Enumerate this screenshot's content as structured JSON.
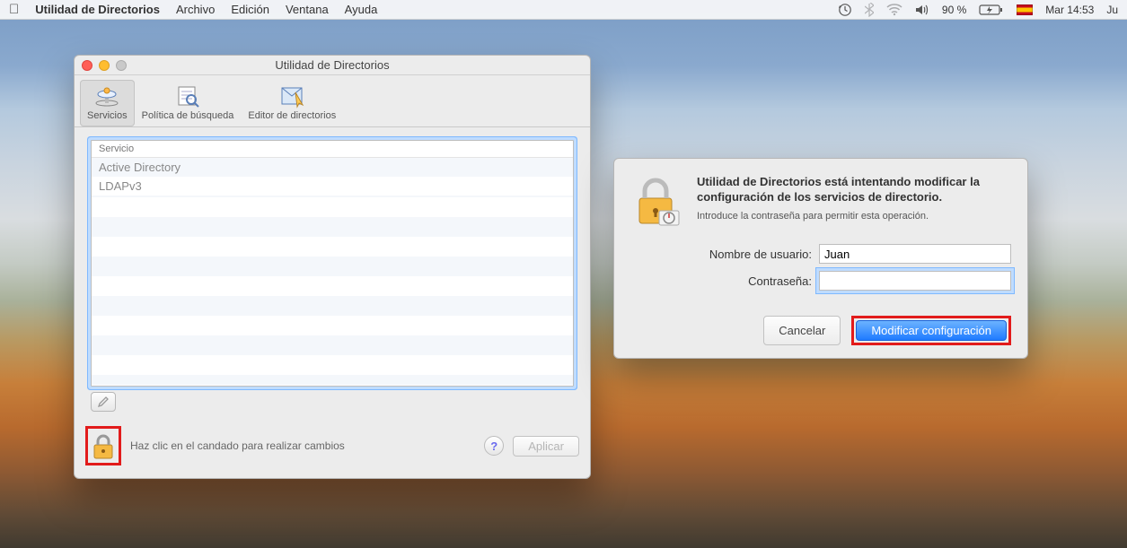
{
  "menubar": {
    "app": "Utilidad de Directorios",
    "items": [
      "Archivo",
      "Edición",
      "Ventana",
      "Ayuda"
    ],
    "battery": "90 %",
    "clock": "Mar 14:53",
    "clock_extra": "Ju"
  },
  "window": {
    "title": "Utilidad de Directorios",
    "tabs": {
      "servicios": "Servicios",
      "politica": "Política de búsqueda",
      "editor": "Editor de directorios"
    },
    "list_header": "Servicio",
    "services": [
      "Active Directory",
      "LDAPv3"
    ],
    "lock_hint": "Haz clic en el candado para realizar cambios",
    "apply": "Aplicar"
  },
  "dialog": {
    "headline": "Utilidad de Directorios está intentando modificar la configuración de los servicios de directorio.",
    "sub": "Introduce la contraseña para permitir esta operación.",
    "username_label": "Nombre de usuario:",
    "username_value": "Juan",
    "password_label": "Contraseña:",
    "cancel": "Cancelar",
    "confirm": "Modificar configuración"
  }
}
